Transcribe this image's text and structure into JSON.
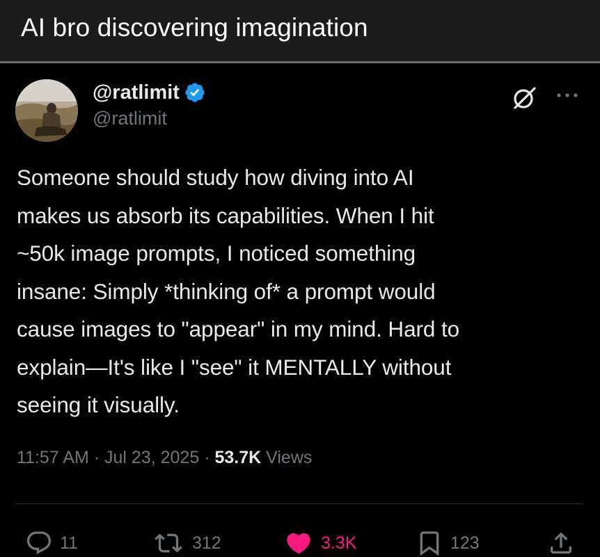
{
  "caption": {
    "title": "AI bro discovering imagination"
  },
  "post": {
    "author": {
      "display_name": "@ratlimit",
      "handle": "@ratlimit",
      "verified": true,
      "verified_color": "#1d9bf0"
    },
    "body": "Someone should study how diving into AI\nmakes us absorb its capabilities. When I hit\n~50k image prompts, I noticed something\ninsane: Simply *thinking of* a prompt would\ncause images to \"appear\" in my mind. Hard to\nexplain—It's like I \"see\" it MENTALLY without\nseeing it visually.",
    "meta": {
      "time": "11:57 AM",
      "separator": "·",
      "date": "Jul 23, 2025",
      "views_count": "53.7K",
      "views_label": "Views"
    },
    "actions": {
      "replies": "11",
      "reposts": "312",
      "likes": "3.3K",
      "bookmarks": "123"
    },
    "colors": {
      "background": "#000000",
      "text": "#e7e9ea",
      "muted": "#71767b",
      "like": "#f91880",
      "divider": "#2f3336"
    },
    "icons": {
      "header_right": [
        "grok-icon",
        "more-icon"
      ],
      "actions": [
        "reply-icon",
        "repost-icon",
        "like-icon",
        "bookmark-icon",
        "share-icon"
      ]
    }
  }
}
